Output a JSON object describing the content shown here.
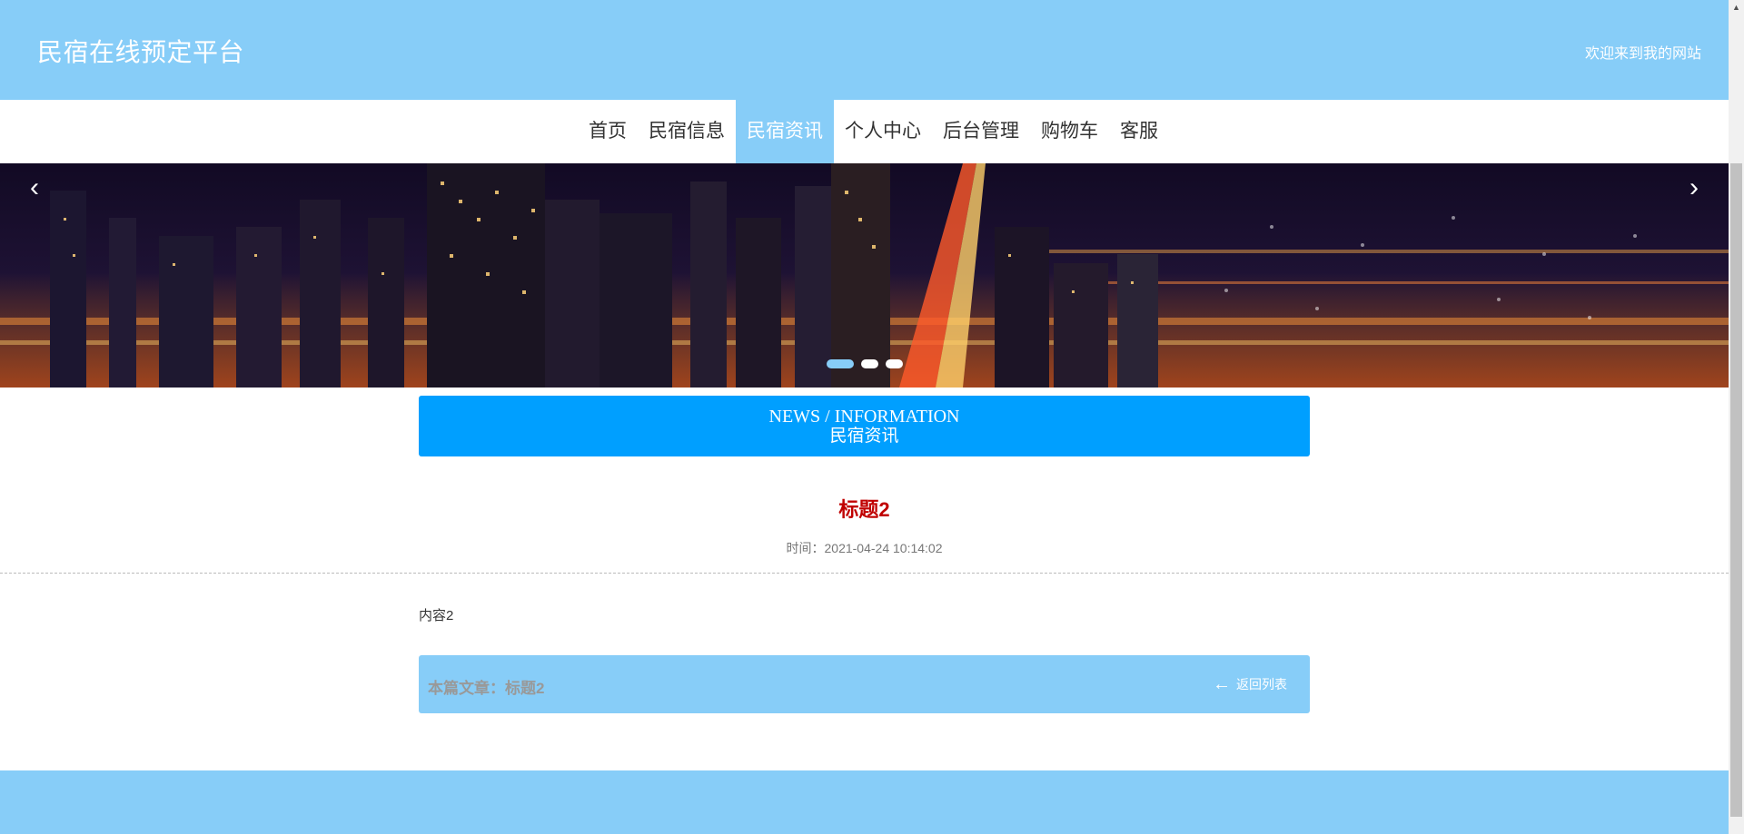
{
  "header": {
    "site_title": "民宿在线预定平台",
    "welcome": "欢迎来到我的网站"
  },
  "nav": {
    "items": [
      {
        "label": "首页"
      },
      {
        "label": "民宿信息"
      },
      {
        "label": "民宿资讯"
      },
      {
        "label": "个人中心"
      },
      {
        "label": "后台管理"
      },
      {
        "label": "购物车"
      },
      {
        "label": "客服"
      }
    ],
    "active_index": 2
  },
  "banner": {
    "prev_icon": "chevron-left-icon",
    "next_icon": "chevron-right-icon",
    "slide_count": 3,
    "active_slide": 1
  },
  "section": {
    "title_en": "NEWS / INFORMATION",
    "title_cn": "民宿资讯"
  },
  "article": {
    "title": "标题2",
    "time": "时间：2021-04-24 10:14:02",
    "content": "内容2",
    "this_article": "本篇文章：标题2",
    "back_label": "返回列表"
  },
  "colors": {
    "header_bg": "#87CDF8",
    "section_bg": "#009FFF",
    "article_title": "#C00000"
  }
}
